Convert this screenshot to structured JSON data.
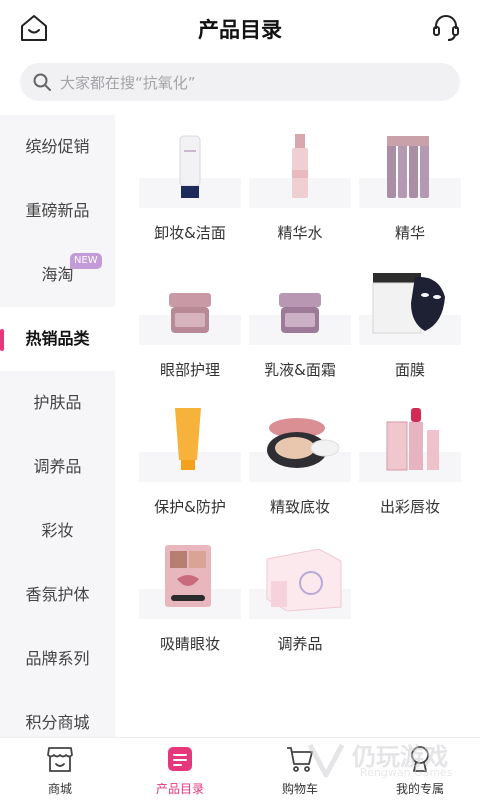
{
  "header": {
    "title": "产品目录"
  },
  "search": {
    "placeholder": "大家都在搜“抗氧化”"
  },
  "sidebar": {
    "active_index": 3,
    "items": [
      {
        "label": "缤纷促销"
      },
      {
        "label": "重磅新品"
      },
      {
        "label": "海淘",
        "badge": "NEW"
      },
      {
        "label": "热销品类"
      },
      {
        "label": "护肤品"
      },
      {
        "label": "调养品"
      },
      {
        "label": "彩妆"
      },
      {
        "label": "香氛护体"
      },
      {
        "label": "品牌系列"
      },
      {
        "label": "积分商城"
      }
    ]
  },
  "categories": [
    {
      "label": "卸妆&洁面",
      "icon": "cleanser-tube-icon"
    },
    {
      "label": "精华水",
      "icon": "essence-bottle-icon"
    },
    {
      "label": "精华",
      "icon": "serum-vials-icon"
    },
    {
      "label": "眼部护理",
      "icon": "eye-cream-jar-icon"
    },
    {
      "label": "乳液&面霜",
      "icon": "face-cream-jar-icon"
    },
    {
      "label": "面膜",
      "icon": "face-mask-icon"
    },
    {
      "label": "保护&防护",
      "icon": "sunscreen-tube-icon"
    },
    {
      "label": "精致底妆",
      "icon": "cushion-compact-icon"
    },
    {
      "label": "出彩唇妆",
      "icon": "lipstick-icon"
    },
    {
      "label": "吸睛眼妆",
      "icon": "eyeshadow-palette-icon"
    },
    {
      "label": "调养品",
      "icon": "supplement-box-icon"
    }
  ],
  "tabbar": {
    "active_index": 1,
    "items": [
      {
        "label": "商城",
        "icon": "store-icon"
      },
      {
        "label": "产品目录",
        "icon": "catalog-icon"
      },
      {
        "label": "购物车",
        "icon": "cart-icon"
      },
      {
        "label": "我的专属",
        "icon": "profile-icon"
      }
    ]
  },
  "watermark": {
    "text": "仍玩游戏",
    "sub": "Rengwan Games"
  },
  "colors": {
    "accent": "#e6377d",
    "sidebar_bg": "#f6f6f8",
    "search_bg": "#f1f1f3",
    "badge": "#c39bd6"
  }
}
